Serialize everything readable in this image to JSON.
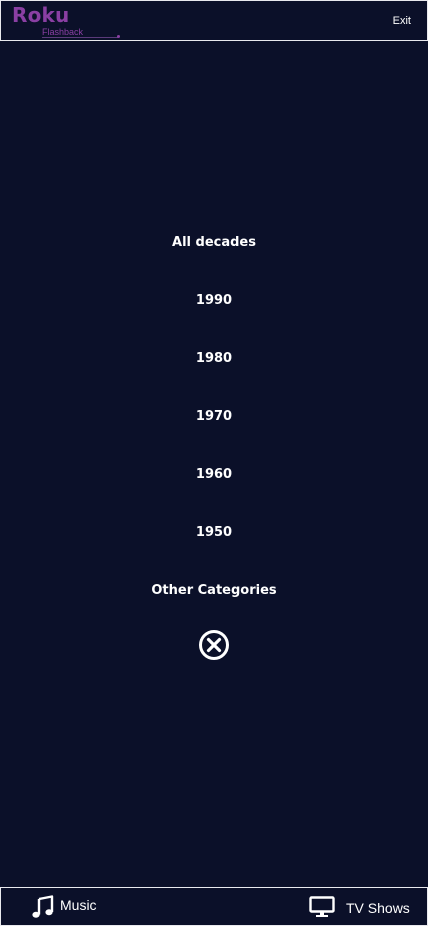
{
  "header": {
    "logo": {
      "brand": "Roku",
      "subtitle": "Flashback"
    },
    "exit_label": "Exit"
  },
  "menu": {
    "items": [
      {
        "label": "All decades"
      },
      {
        "label": "1990"
      },
      {
        "label": "1980"
      },
      {
        "label": "1970"
      },
      {
        "label": "1960"
      },
      {
        "label": "1950"
      },
      {
        "label": "Other Categories"
      }
    ],
    "close_icon": "circle-x-icon"
  },
  "bottom_nav": {
    "items": [
      {
        "label": "Music",
        "icon": "music-note-icon"
      },
      {
        "label": "TV Shows",
        "icon": "monitor-icon"
      }
    ]
  },
  "colors": {
    "background": "#0b1029",
    "brand": "#8a3fa3",
    "text": "#ffffff",
    "border": "#e9e9ee"
  }
}
